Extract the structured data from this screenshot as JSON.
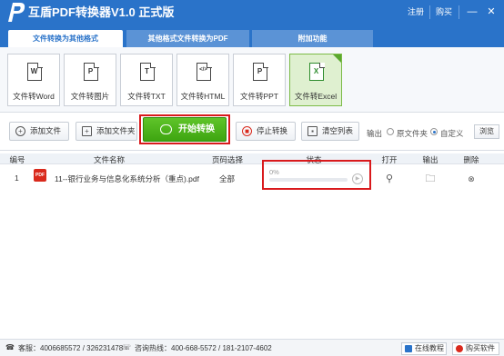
{
  "app": {
    "title": "互盾PDF转换器V1.0 正式版"
  },
  "titlebar": {
    "register_label": "注册",
    "buy_label": "购买",
    "minimize": "—",
    "close": "✕"
  },
  "tabs": [
    {
      "label": "文件转换为其他格式",
      "active": true
    },
    {
      "label": "其他格式文件转换为PDF",
      "active": false
    },
    {
      "label": "附加功能",
      "active": false
    }
  ],
  "formats": [
    {
      "letter": "W",
      "label": "文件转Word",
      "selected": false
    },
    {
      "letter": "P",
      "label": "文件转图片",
      "selected": false
    },
    {
      "letter": "T",
      "label": "文件转TXT",
      "selected": false
    },
    {
      "letter": "</>",
      "label": "文件转HTML",
      "selected": false
    },
    {
      "letter": "P",
      "label": "文件转PPT",
      "selected": false
    },
    {
      "letter": "X",
      "label": "文件转Excel",
      "selected": true
    }
  ],
  "toolbar": {
    "add_file": "添加文件",
    "add_folder": "添加文件夹",
    "start": "开始转换",
    "stop": "停止转换",
    "clear": "清空列表",
    "output_label": "输出",
    "original_folder": "原文件夹",
    "custom": "自定义",
    "browse": "浏览"
  },
  "table": {
    "headers": {
      "index": "编号",
      "name": "文件名称",
      "pages": "页码选择",
      "status": "状态",
      "open": "打开",
      "output": "输出",
      "delete": "删除"
    },
    "rows": [
      {
        "index": "1",
        "name": "11--银行业务与信息化系统分析（重点).pdf",
        "pages": "全部",
        "progress_text": "0%",
        "progress": 0
      }
    ]
  },
  "statusbar": {
    "support": "客服：4006685572 / 326231478",
    "hotline": "咨询热线：400-668-5572 / 181-2107-4602",
    "online_tutorial": "在线教程",
    "buy_software": "购买软件"
  },
  "colors": {
    "brand": "#2a73c9",
    "start_green": "#4cb51c",
    "highlight_red": "#d9191c",
    "excel_green": "#2d8c2d"
  }
}
